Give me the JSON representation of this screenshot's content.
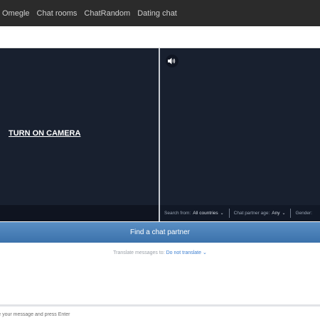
{
  "nav": {
    "items": [
      "Omegle",
      "Chat rooms",
      "ChatRandom",
      "Dating chat"
    ]
  },
  "video": {
    "camera_label": "TURN ON CAMERA"
  },
  "filters": {
    "search_label": "Search from:",
    "search_value": "All countries",
    "age_label": "Chat partner age:",
    "age_value": "Any",
    "gender_label": "Gender:"
  },
  "actions": {
    "find_label": "Find a chat partner"
  },
  "translate": {
    "label": "Translate messages to:",
    "option": "Do not translate"
  },
  "chat": {
    "input_placeholder": "Type your message and press Enter"
  },
  "icons": {
    "sound": "speaker-icon",
    "chevron": "chevron-down-icon"
  },
  "colors": {
    "topbar": "#2b2b2b",
    "video_bg": "#18202f",
    "button": "#4a82bb",
    "link": "#3d7fd0"
  }
}
